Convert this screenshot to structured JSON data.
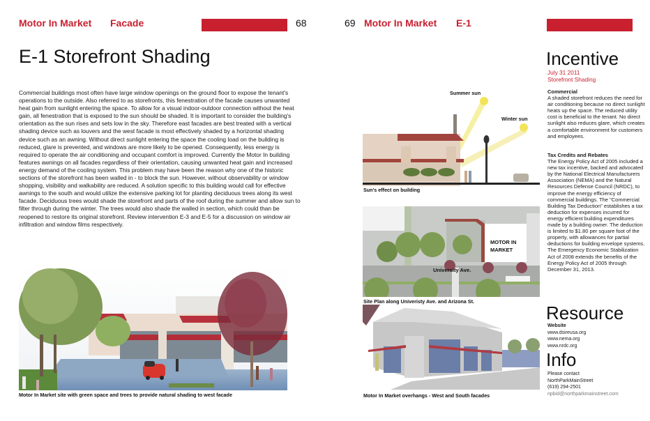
{
  "left_page": {
    "header": {
      "project": "Motor In Market",
      "section": "Facade",
      "page_number": "68"
    },
    "title": "E-1 Storefront Shading",
    "body": "Commercial buildings most often have large window openings on the ground floor to expose the tenant's operations to the outside. Also referred to as storefronts, this fenestration of the facade causes unwanted heat gain from sunlight entering the space. To allow for a visual indoor-outdoor connection without the heat gain, all fenestration that is exposed to the sun should be shaded. It is important to consider the building's orientation as the sun rises and sets low in the sky. Therefore east facades are best treated with a vertical shading device such as louvers and the west facade is most effectively shaded by a horizontal shading device such as an awning. Without direct sunlight entering the space the cooling load on the building is reduced, glare is prevented, and windows are more likely to be opened. Consequently, less energy is required to operate the air conditioning and occupant comfort is improved. Currently the Motor In building features awnings on all facades regardless of their orientation, causing unwanted heat gain and increased energy demand of the cooling system. This problem may have been the reason why one of the historic sections of the storefront has been walled in - to block the sun. However, without observability or window shopping, visibility and  walkability are reduced. A solution specific to this building would call for effective awnings to the south and would utilize the extensive parking lot for planting deciduous trees along its west facade. Deciduous trees would shade the storefront and parts of the roof during the summer and allow sun to filter through during the winter. The trees would also shade the walled in section, which could than be reopened to restore its original storefront. Review intervention E-3 and E-5 for a discussion on window air infiltration and window films respectively.",
    "photo_caption": "Motor In Market site with green space and trees to provide natural shading to west facade"
  },
  "right_page": {
    "header": {
      "page_number": "69",
      "project": "Motor In Market",
      "section": "E-1"
    },
    "figures": [
      {
        "caption": "Sun's effect on building",
        "labels": {
          "summer": "Summer sun",
          "winter": "Winter sun"
        }
      },
      {
        "caption": "Site Plan along Univeristy Ave. and Arizona St.",
        "labels": {
          "building": "MOTOR IN MARKET",
          "street": "University Ave."
        }
      },
      {
        "caption": "Motor In Market overhangs - West and South facades"
      }
    ],
    "sidebar": {
      "incentive": {
        "heading": "Incentive",
        "date": "July 31 2011",
        "topic": "Storefront Shading",
        "commercial_title": "Commercial",
        "commercial_text": "A shaded storefront reduces the need for air conditioning because no direct sunlight heats up the space. The reduced utility cost is beneficial to the tenant. No direct sunlight also reduces glare, which creates a comfortable environment for customers and employees.",
        "tax_title": "Tax Credits and Rebates",
        "tax_text": "The Energy Policy Act of 2005 included a new tax incentive, backed and advocated by the National Electrical Manufacturers Association (NEMA) and the Natural Resources Defense Council (NRDC), to improve the energy efficiency of commercial buildings. The \"Commercial Building Tax Deduction\" establishes a tax deduction for expenses incurred for energy efficient building expenditures made by a building owner. The deduction is limited to $1.80 per square foot of the property, with allowances for partial deductions for building envelope systems. The Emergency Economic Stabilization Act of 2008 extends the benefits of the Energy Policy Act of 2005 through December 31, 2013."
      },
      "resource": {
        "heading": "Resource",
        "website_title": "Website",
        "links": [
          "www.dsireusa.org",
          "www.nema.org",
          "www.nrdc.org"
        ]
      },
      "info": {
        "heading": "Info",
        "lines": [
          "Please contact",
          "NorthParkMainStreet",
          "(619) 294-2501"
        ],
        "email": "npbid@northparkmainstreet.com"
      }
    }
  },
  "colors": {
    "accent": "#c8202f",
    "text": "#111111",
    "muted": "#777777"
  }
}
